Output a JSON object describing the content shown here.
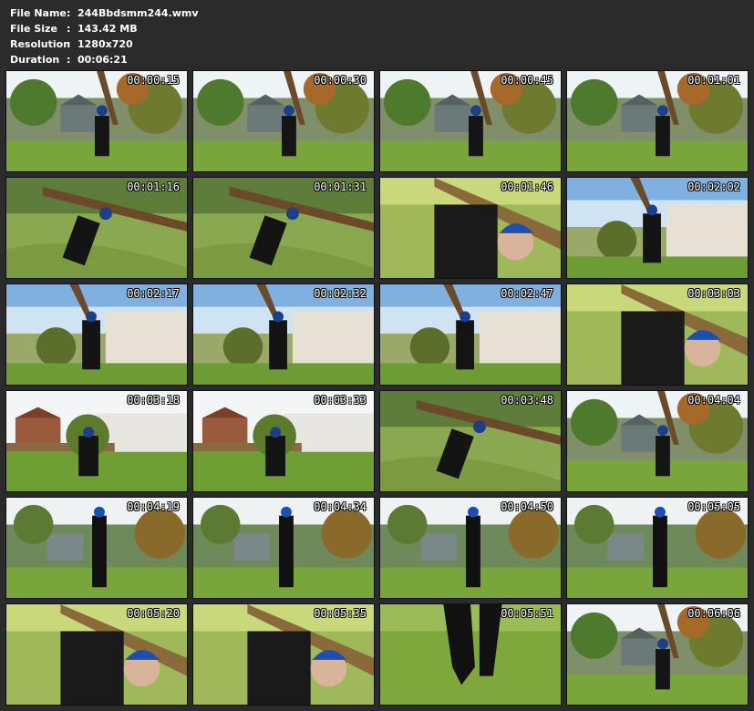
{
  "info": [
    {
      "key": "File Name",
      "value": "244Bbdsmm244.wmv"
    },
    {
      "key": "File Size",
      "value": "143.42 MB"
    },
    {
      "key": "Resolution",
      "value": "1280x720"
    },
    {
      "key": "Duration",
      "value": "00:06:21"
    }
  ],
  "thumbnails": [
    {
      "timestamp": "00:00:15",
      "scene": "garden"
    },
    {
      "timestamp": "00:00:30",
      "scene": "garden"
    },
    {
      "timestamp": "00:00:45",
      "scene": "garden"
    },
    {
      "timestamp": "00:01:01",
      "scene": "garden"
    },
    {
      "timestamp": "00:01:16",
      "scene": "tree-low"
    },
    {
      "timestamp": "00:01:31",
      "scene": "tree-low"
    },
    {
      "timestamp": "00:01:46",
      "scene": "closeup"
    },
    {
      "timestamp": "00:02:02",
      "scene": "fence"
    },
    {
      "timestamp": "00:02:17",
      "scene": "fence"
    },
    {
      "timestamp": "00:02:32",
      "scene": "fence"
    },
    {
      "timestamp": "00:02:47",
      "scene": "fence"
    },
    {
      "timestamp": "00:03:03",
      "scene": "closeup"
    },
    {
      "timestamp": "00:03:18",
      "scene": "house"
    },
    {
      "timestamp": "00:03:33",
      "scene": "house"
    },
    {
      "timestamp": "00:03:48",
      "scene": "tree-low"
    },
    {
      "timestamp": "00:04:04",
      "scene": "garden"
    },
    {
      "timestamp": "00:04:19",
      "scene": "standing"
    },
    {
      "timestamp": "00:04:34",
      "scene": "standing"
    },
    {
      "timestamp": "00:04:50",
      "scene": "standing"
    },
    {
      "timestamp": "00:05:05",
      "scene": "standing"
    },
    {
      "timestamp": "00:05:20",
      "scene": "closeup"
    },
    {
      "timestamp": "00:05:35",
      "scene": "closeup"
    },
    {
      "timestamp": "00:05:51",
      "scene": "grass"
    },
    {
      "timestamp": "00:06:06",
      "scene": "garden"
    }
  ]
}
